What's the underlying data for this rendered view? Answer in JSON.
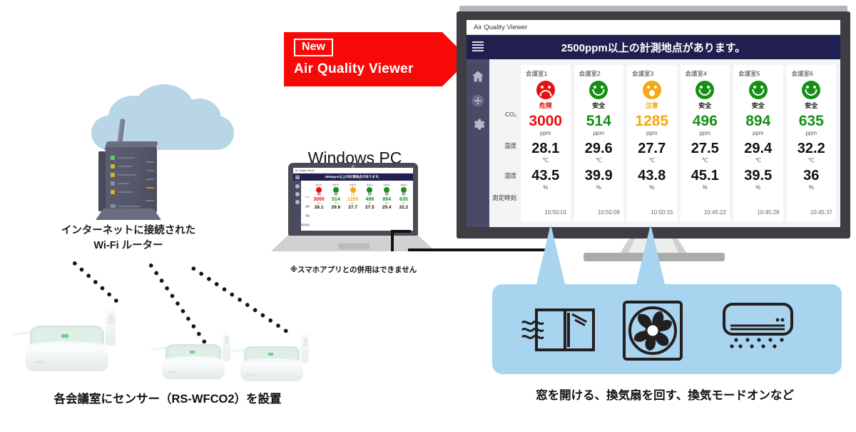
{
  "banner": {
    "new_label": "New",
    "product": "Air Quality Viewer"
  },
  "captions": {
    "router": "インターネットに接続された\nWi-Fi ルーター",
    "sensor": "各会議室にセンサー（RS-WFCO2）を設置",
    "action": "窓を開ける、換気扇を回す、換気モードオンなど",
    "pc": "Windows PC",
    "pc_note": "※スマホアプリとの併用はできません"
  },
  "dashboard": {
    "window_title": "Air Quality Viewer",
    "alert": "2500ppm以上の計測地点があります。",
    "sidebar": [
      {
        "name": "home-icon"
      },
      {
        "name": "add-icon"
      },
      {
        "name": "settings-icon"
      }
    ],
    "row_labels": {
      "co2": "CO₂",
      "temperature": "温度",
      "humidity": "湿度",
      "measured_at": "測定時刻"
    },
    "units": {
      "co2": "ppm",
      "temperature": "℃",
      "humidity": "%"
    },
    "columns": [
      {
        "room": "会議室1",
        "status": "危険",
        "face": "sad",
        "color": "#e81010",
        "co2": "3000",
        "temperature": "28.1",
        "humidity": "43.5",
        "time": "10:50:01"
      },
      {
        "room": "会議室2",
        "status": "安全",
        "face": "smile",
        "color": "#159015",
        "co2": "514",
        "temperature": "29.6",
        "humidity": "39.9",
        "time": "10:50:09"
      },
      {
        "room": "会議室3",
        "status": "注意",
        "face": "surprise",
        "color": "#f5a814",
        "co2": "1285",
        "temperature": "27.7",
        "humidity": "43.8",
        "time": "10:50:15"
      },
      {
        "room": "会議室4",
        "status": "安全",
        "face": "smile",
        "color": "#159015",
        "co2": "496",
        "temperature": "27.5",
        "humidity": "45.1",
        "time": "10:45:22"
      },
      {
        "room": "会議室5",
        "status": "安全",
        "face": "smile",
        "color": "#159015",
        "co2": "894",
        "temperature": "29.4",
        "humidity": "39.5",
        "time": "10:45:28"
      },
      {
        "room": "会議室6",
        "status": "安全",
        "face": "smile",
        "color": "#159015",
        "co2": "635",
        "temperature": "32.2",
        "humidity": "36",
        "time": "10:45:37"
      }
    ]
  },
  "action_panel": {
    "icons": [
      "open-window-icon",
      "ventilation-fan-icon",
      "air-conditioner-icon"
    ],
    "bg_color": "#a8d4f0"
  },
  "devices": {
    "cloud": {
      "name": "internet-cloud",
      "color": "#b9d6e6"
    },
    "router": {
      "name": "wifi-router"
    },
    "sensors": [
      {
        "name": "co2-sensor-1"
      },
      {
        "name": "co2-sensor-2"
      },
      {
        "name": "co2-sensor-3"
      }
    ]
  },
  "colors": {
    "alert_bg": "#1f1f50",
    "sidebar_bg": "#4a4a66",
    "banner_red": "#fa0808",
    "danger": "#e81010",
    "safe": "#159015",
    "caution": "#f5a814"
  }
}
